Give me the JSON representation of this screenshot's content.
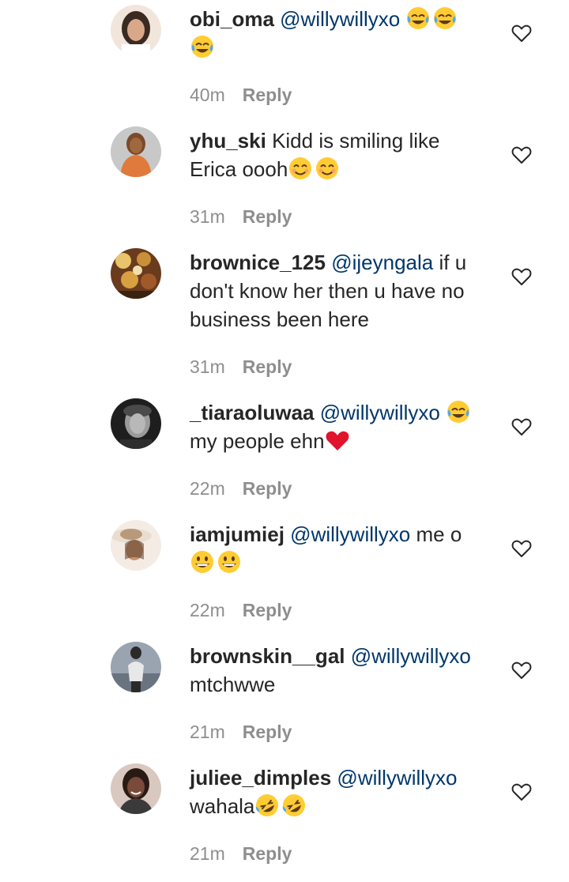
{
  "comments": [
    {
      "avatar": "avatar-woman-portrait",
      "avatar_colors": [
        "#d9c7b8",
        "#3a2a22",
        "#f2e6dc"
      ],
      "username": "obi_oma",
      "mention": "@willywillyxo",
      "text_line1": "",
      "text_line2": "",
      "emoji_line1": [
        "tears-of-joy",
        "tears-of-joy"
      ],
      "emoji_line2": [
        "tears-of-joy"
      ],
      "time": "40m",
      "reply": "Reply"
    },
    {
      "avatar": "avatar-woman-orange-dress",
      "avatar_colors": [
        "#e07a3c",
        "#7a4a2a",
        "#c8c8c8"
      ],
      "username": "yhu_ski",
      "text_line1": "Kidd is smiling like",
      "text_line2": "Erica oooh",
      "emoji_line2": [
        "smiling-eyes",
        "smiling-eyes"
      ],
      "time": "31m",
      "reply": "Reply"
    },
    {
      "avatar": "avatar-food-platter",
      "avatar_colors": [
        "#c9903a",
        "#6b3b1e",
        "#e8c46a"
      ],
      "username": "brownice_125",
      "mention": "@ijeyngala",
      "text_line1": "if u",
      "text_line2": "don't know her then u have no",
      "text_line3": "business been here",
      "time": "31m",
      "reply": "Reply"
    },
    {
      "avatar": "avatar-bw-portrait",
      "avatar_colors": [
        "#4a4a4a",
        "#9a9a9a",
        "#1e1e1e"
      ],
      "username": "_tiaraoluwaa",
      "mention": "@willywillyxo",
      "emoji_line1": [
        "tears-of-joy"
      ],
      "text_line2": "my people ehn",
      "emoji_line2": [
        "red-heart"
      ],
      "time": "22m",
      "reply": "Reply"
    },
    {
      "avatar": "avatar-woman-hat",
      "avatar_colors": [
        "#e9ddd0",
        "#b89a7a",
        "#5a3a2a"
      ],
      "username": "iamjumiej",
      "mention": "@willywillyxo",
      "text_line1": "me o",
      "emoji_line2": [
        "grinning",
        "grinning"
      ],
      "time": "22m",
      "reply": "Reply"
    },
    {
      "avatar": "avatar-woman-standing",
      "avatar_colors": [
        "#9aa4b0",
        "#2a2a2a",
        "#e8e8e8"
      ],
      "username": "brownskin__gal",
      "mention": "@willywillyxo",
      "text_line2": "mtchwwe",
      "time": "21m",
      "reply": "Reply"
    },
    {
      "avatar": "avatar-woman-smiling",
      "avatar_colors": [
        "#7a4a3a",
        "#2a1a14",
        "#d8c8c0"
      ],
      "username": "juliee_dimples",
      "mention": "@willywillyxo",
      "text_line2": "wahala",
      "emoji_line2": [
        "rolling-laughing",
        "rolling-laughing"
      ],
      "time": "21m",
      "reply": "Reply"
    }
  ],
  "colors": {
    "text": "#262626",
    "mention": "#00376b",
    "meta": "#8e8e8e",
    "heart_stroke": "#262626"
  },
  "icons": {
    "like": "heart-outline-icon"
  }
}
